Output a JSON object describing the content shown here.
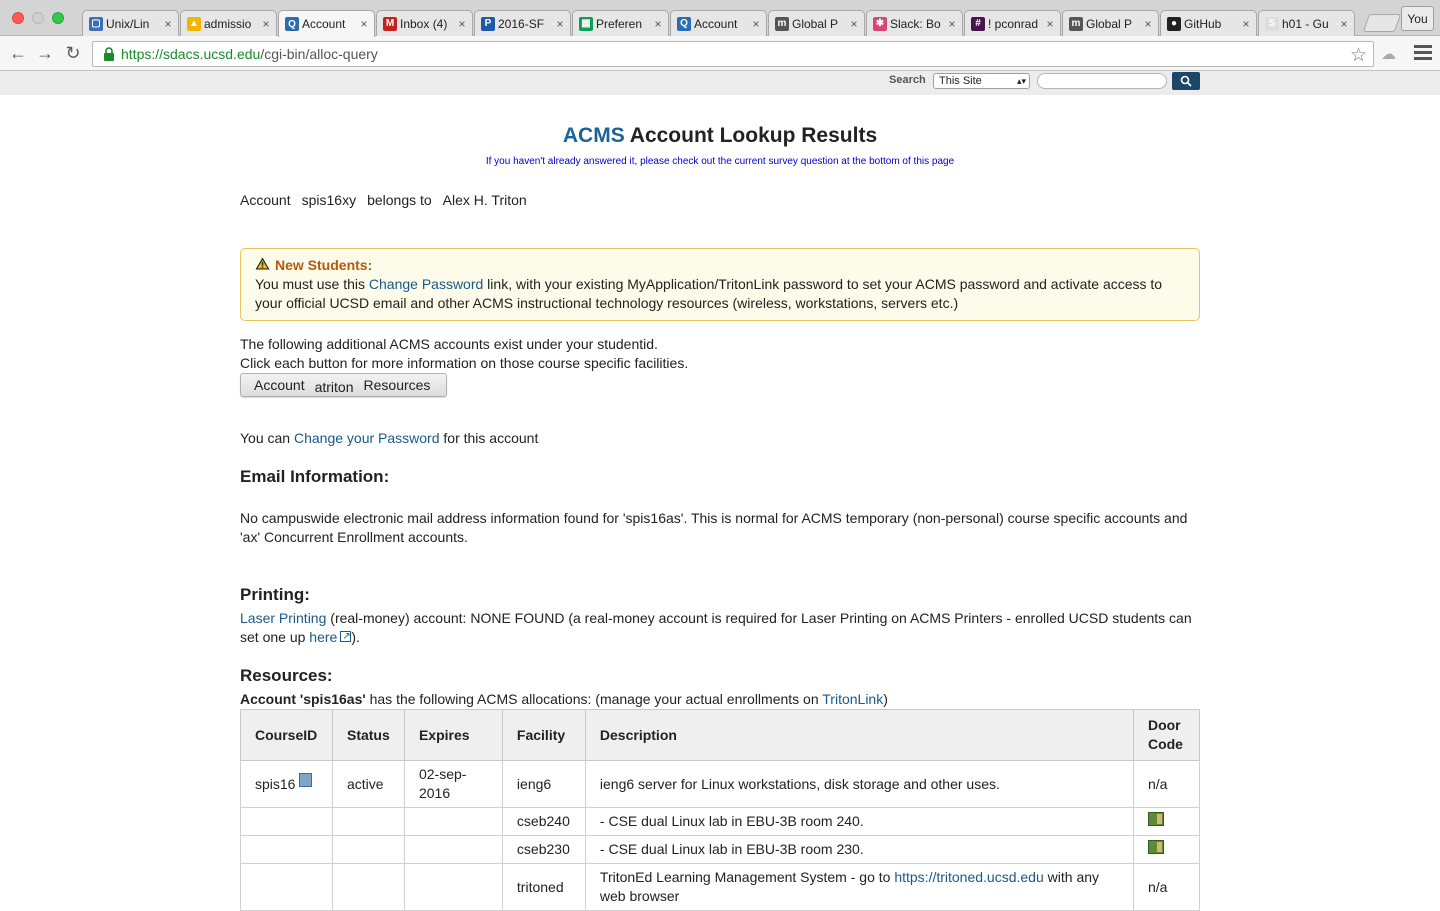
{
  "browser": {
    "tabs": [
      {
        "label": "Unix/Lin",
        "favicon_color": "#3b6fb6",
        "favicon_glyph": "▢"
      },
      {
        "label": "admissio",
        "favicon_color": "#f2b400",
        "favicon_glyph": "▲"
      },
      {
        "label": "Account",
        "favicon_color": "#2a6db0",
        "favicon_glyph": "Q",
        "active": true
      },
      {
        "label": "Inbox (4)",
        "favicon_color": "#c5221f",
        "favicon_glyph": "M"
      },
      {
        "label": "2016-SF",
        "favicon_color": "#1f5aa6",
        "favicon_glyph": "P"
      },
      {
        "label": "Preferen",
        "favicon_color": "#0f9d58",
        "favicon_glyph": "▦"
      },
      {
        "label": "Account",
        "favicon_color": "#2a6db0",
        "favicon_glyph": "Q"
      },
      {
        "label": "Global P",
        "favicon_color": "#555555",
        "favicon_glyph": "m"
      },
      {
        "label": "Slack: Bo",
        "favicon_color": "#d6457a",
        "favicon_glyph": "✱"
      },
      {
        "label": "! pconrad",
        "favicon_color": "#4a154b",
        "favicon_glyph": "#"
      },
      {
        "label": "Global P",
        "favicon_color": "#555555",
        "favicon_glyph": "m"
      },
      {
        "label": "GitHub",
        "favicon_color": "#222222",
        "favicon_glyph": "●"
      },
      {
        "label": "h01 - Gu",
        "favicon_color": "#dddddd",
        "favicon_glyph": "S"
      }
    ],
    "profile_label": "You",
    "url_host": "https://sdacs.ucsd.edu",
    "url_path": "/cgi-bin/alloc-query"
  },
  "site_search": {
    "label": "Search",
    "scope": "This Site"
  },
  "page": {
    "title_brand": "ACMS",
    "title_rest": " Account Lookup Results",
    "survey_text": "If you haven't already answered it, please check out the current survey question at the bottom of this page",
    "account_label": "Account",
    "account_id": "spis16xy",
    "belongs_label": "belongs to",
    "owner_name": "Alex H. Triton",
    "notice_heading": "New Students:",
    "notice_pre": "You must use this ",
    "notice_link": "Change Password",
    "notice_post": " link, with your existing MyApplication/TritonLink password to set your ACMS password and activate access to your official UCSD email and other ACMS instructional technology resources (wireless, workstations, servers etc.)",
    "additional_line1": "The following additional ACMS accounts exist under your studentid.",
    "additional_line2": "Click each button for more information on those course specific facilities.",
    "button_account": "Account",
    "button_name": "atriton",
    "button_resources": "Resources",
    "change_pre": "You can ",
    "change_link": "Change your Password",
    "change_post": " for this account",
    "email_heading": "Email Information:",
    "email_text": "No campuswide electronic mail address information found for 'spis16as'. This is normal for ACMS temporary (non-personal) course specific accounts and 'ax' Concurrent Enrollment accounts.",
    "printing_heading": "Printing:",
    "printing_link": "Laser Printing",
    "printing_text": " (real-money) account: NONE FOUND (a real-money account is required for Laser Printing on ACMS Printers - enrolled UCSD students can set one up ",
    "printing_here": "here",
    "printing_end": ").",
    "resources_heading": "Resources:",
    "resources_bold": "Account 'spis16as'",
    "resources_text": " has the following ACMS allocations: (manage your actual enrollments on ",
    "resources_link": "TritonLink",
    "resources_end": ")"
  },
  "table": {
    "headers": [
      "CourseID",
      "Status",
      "Expires",
      "Facility",
      "Description",
      "Door Code"
    ],
    "rows": [
      {
        "course": "spis16",
        "status": "active",
        "expires": "02-sep-2016",
        "facility": "ieng6",
        "desc_pre": "ieng6 server for Linux workstations, disk storage and other uses.",
        "desc_link": "",
        "desc_post": "",
        "door": "n/a"
      },
      {
        "course": "",
        "status": "",
        "expires": "",
        "facility": "cseb240",
        "desc_pre": "- CSE dual Linux lab in EBU-3B room 240.",
        "desc_link": "",
        "desc_post": "",
        "door": ""
      },
      {
        "course": "",
        "status": "",
        "expires": "",
        "facility": "cseb230",
        "desc_pre": "- CSE dual Linux lab in EBU-3B room 230.",
        "desc_link": "",
        "desc_post": "",
        "door": ""
      },
      {
        "course": "",
        "status": "",
        "expires": "",
        "facility": "tritoned",
        "desc_pre": "TritonEd Learning Management System - go to ",
        "desc_link": "https://tritoned.ucsd.edu",
        "desc_post": " with any web browser",
        "door": "n/a"
      }
    ]
  }
}
